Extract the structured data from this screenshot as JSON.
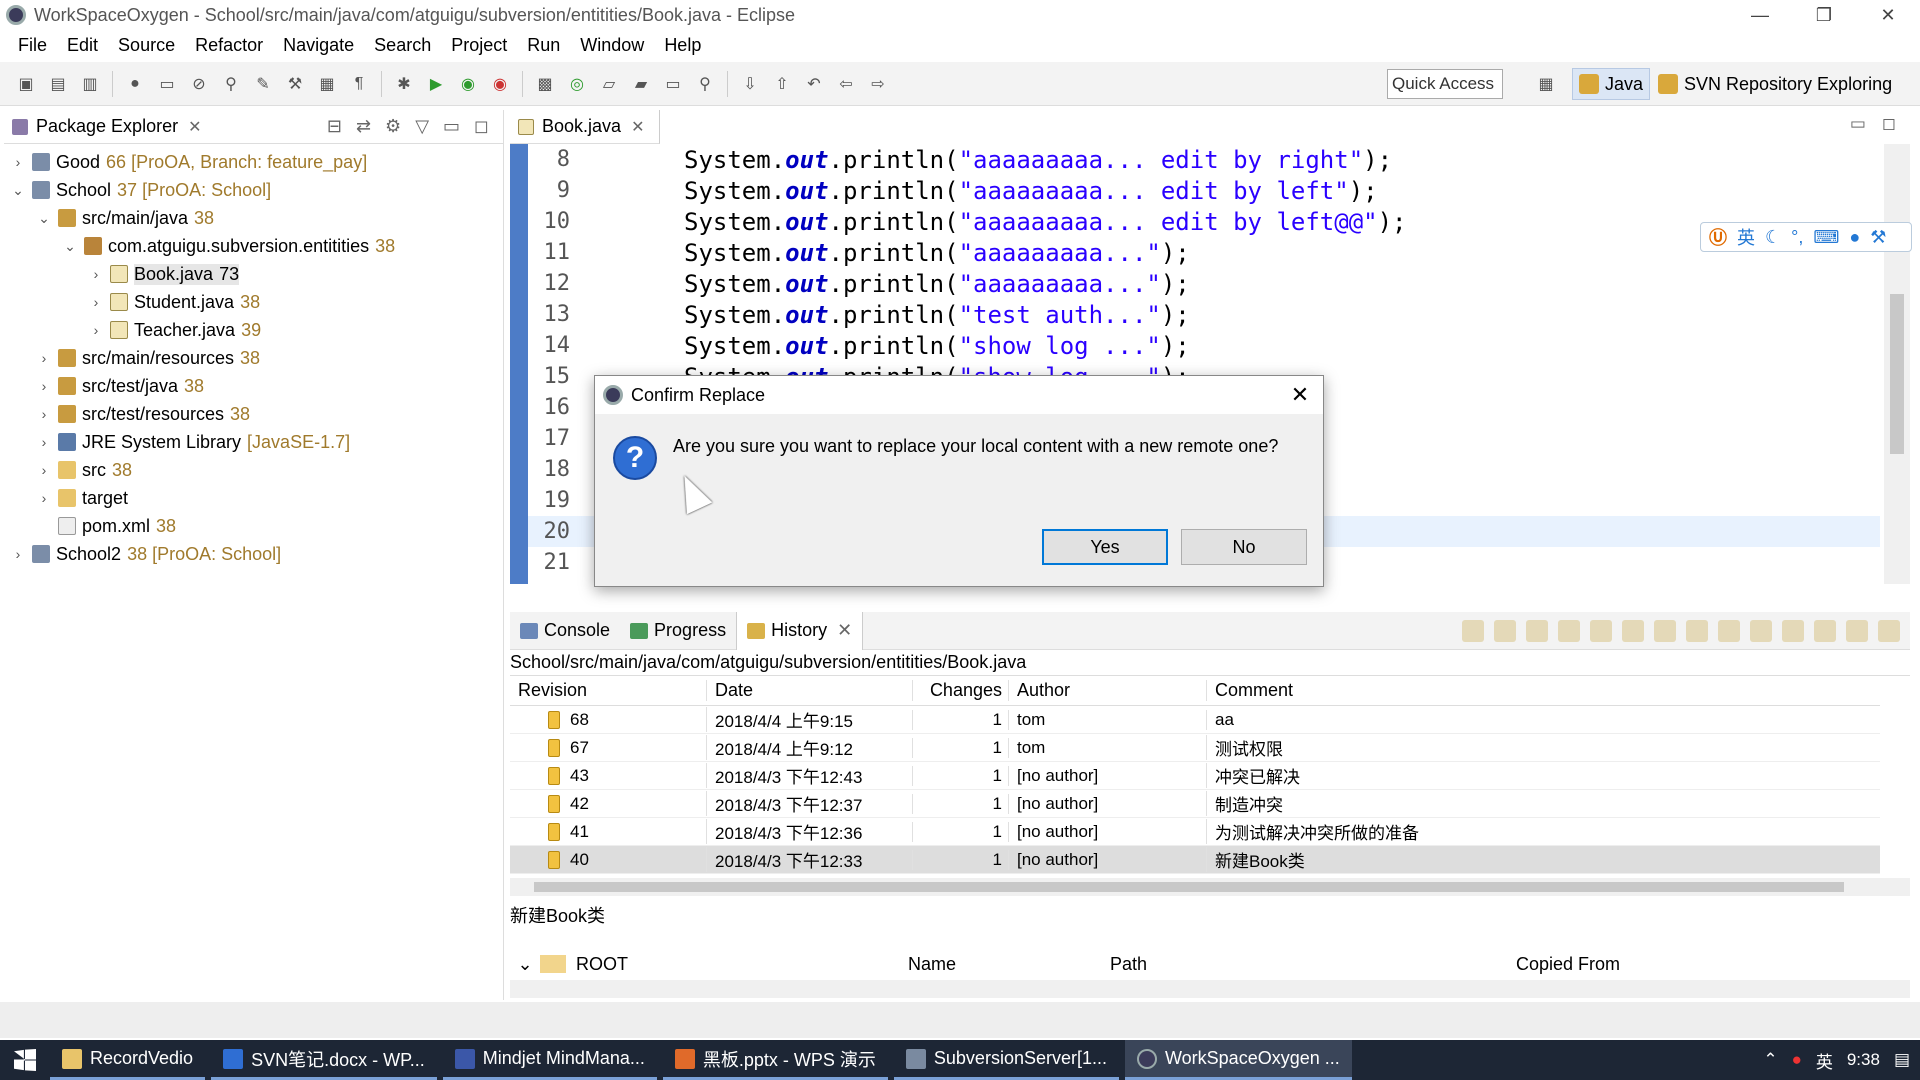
{
  "window": {
    "title": "WorkSpaceOxygen - School/src/main/java/com/atguigu/subversion/entitities/Book.java - Eclipse",
    "controls": [
      "—",
      "❐",
      "✕"
    ]
  },
  "menu": [
    "File",
    "Edit",
    "Source",
    "Refactor",
    "Navigate",
    "Search",
    "Project",
    "Run",
    "Window",
    "Help"
  ],
  "toolbar": {
    "quick_access": "Quick Access",
    "perspectives": [
      "Java",
      "SVN Repository Exploring"
    ]
  },
  "package_explorer": {
    "title": "Package Explorer",
    "items": [
      {
        "label": "Good",
        "deco": "66 [ProOA, Branch: feature_pay]",
        "twisty": "›"
      },
      {
        "label": "School",
        "deco": "37 [ProOA: School]",
        "twisty": "⌄"
      },
      {
        "label": "src/main/java",
        "deco": "38",
        "twisty": "⌄"
      },
      {
        "label": "com.atguigu.subversion.entitities",
        "deco": "38",
        "twisty": "⌄"
      },
      {
        "label": "Book.java",
        "deco": "73",
        "twisty": "›"
      },
      {
        "label": "Student.java",
        "deco": "38",
        "twisty": "›"
      },
      {
        "label": "Teacher.java",
        "deco": "39",
        "twisty": "›"
      },
      {
        "label": "src/main/resources",
        "deco": "38",
        "twisty": "›"
      },
      {
        "label": "src/test/java",
        "deco": "38",
        "twisty": "›"
      },
      {
        "label": "src/test/resources",
        "deco": "38",
        "twisty": "›"
      },
      {
        "label": "JRE System Library",
        "deco": "[JavaSE-1.7]",
        "twisty": "›"
      },
      {
        "label": "src",
        "deco": "38",
        "twisty": "›"
      },
      {
        "label": "target",
        "deco": "",
        "twisty": "›"
      },
      {
        "label": "pom.xml",
        "deco": "38",
        "twisty": ""
      },
      {
        "label": "School2",
        "deco": "38 [ProOA: School]",
        "twisty": "›"
      }
    ]
  },
  "editor": {
    "tab": "Book.java",
    "lines": [
      {
        "n": "8",
        "pre": "System.",
        "kw": "out",
        "mid": ".println(",
        "str": "\"aaaaaaaaa... edit by right\"",
        "post": ");"
      },
      {
        "n": "9",
        "pre": "System.",
        "kw": "out",
        "mid": ".println(",
        "str": "\"aaaaaaaaa... edit by left\"",
        "post": ");"
      },
      {
        "n": "10",
        "pre": "System.",
        "kw": "out",
        "mid": ".println(",
        "str": "\"aaaaaaaaa... edit by left@@\"",
        "post": ");"
      },
      {
        "n": "11",
        "pre": "System.",
        "kw": "out",
        "mid": ".println(",
        "str": "\"aaaaaaaaa...\"",
        "post": ");"
      },
      {
        "n": "12",
        "pre": "System.",
        "kw": "out",
        "mid": ".println(",
        "str": "\"aaaaaaaaa...\"",
        "post": ");"
      },
      {
        "n": "13",
        "pre": "System.",
        "kw": "out",
        "mid": ".println(",
        "str": "\"test auth...\"",
        "post": ");"
      },
      {
        "n": "14",
        "pre": "System.",
        "kw": "out",
        "mid": ".println(",
        "str": "\"show log ...\"",
        "post": ");"
      },
      {
        "n": "15",
        "pre": "System.",
        "kw": "out",
        "mid": ".println(",
        "str": "\"show log ...\"",
        "post": ");"
      },
      {
        "n": "16",
        "pre": "",
        "kw": "",
        "mid": "",
        "str": "",
        "post": ""
      },
      {
        "n": "17",
        "pre": "",
        "kw": "",
        "mid": "",
        "str": "",
        "post": ""
      },
      {
        "n": "18",
        "pre": "",
        "kw": "",
        "mid": "",
        "str": "",
        "post": ""
      },
      {
        "n": "19",
        "pre": "",
        "kw": "",
        "mid": "",
        "str": "",
        "post": ""
      },
      {
        "n": "20",
        "pre": "}",
        "kw": "",
        "mid": "",
        "str": "",
        "post": ""
      },
      {
        "n": "21",
        "pre": "",
        "kw": "",
        "mid": "",
        "str": "",
        "post": ""
      }
    ]
  },
  "ime_bar": {
    "lang": "英"
  },
  "dialog": {
    "title": "Confirm Replace",
    "message": "Are you sure you want to replace your local content with a new remote one?",
    "yes": "Yes",
    "no": "No",
    "close": "✕",
    "icon": "?"
  },
  "bottom_panel": {
    "tabs": [
      "Console",
      "Progress",
      "History"
    ],
    "path": "School/src/main/java/com/atguigu/subversion/entitities/Book.java",
    "columns": [
      "Revision",
      "Date",
      "Changes",
      "Author",
      "Comment"
    ],
    "rows": [
      {
        "rev": "68",
        "date": "2018/4/4 上午9:15",
        "changes": "1",
        "author": "tom",
        "comment": "aa"
      },
      {
        "rev": "67",
        "date": "2018/4/4 上午9:12",
        "changes": "1",
        "author": "tom",
        "comment": "测试权限"
      },
      {
        "rev": "43",
        "date": "2018/4/3 下午12:43",
        "changes": "1",
        "author": "[no author]",
        "comment": "冲突已解决"
      },
      {
        "rev": "42",
        "date": "2018/4/3 下午12:37",
        "changes": "1",
        "author": "[no author]",
        "comment": "制造冲突"
      },
      {
        "rev": "41",
        "date": "2018/4/3 下午12:36",
        "changes": "1",
        "author": "[no author]",
        "comment": "为测试解决冲突所做的准备"
      },
      {
        "rev": "40",
        "date": "2018/4/3 下午12:33",
        "changes": "1",
        "author": "[no author]",
        "comment": "新建Book类"
      }
    ],
    "selected_comment": "新建Book类",
    "root_label": "ROOT",
    "affected_columns": [
      "Name",
      "Path",
      "Copied From"
    ]
  },
  "taskbar": {
    "tasks": [
      "RecordVedio",
      "SVN笔记.docx - WP...",
      "Mindjet MindMana...",
      "黑板.pptx - WPS 演示",
      "SubversionServer[1...",
      "WorkSpaceOxygen ..."
    ],
    "tray_lang": "英",
    "clock": "9:38"
  }
}
